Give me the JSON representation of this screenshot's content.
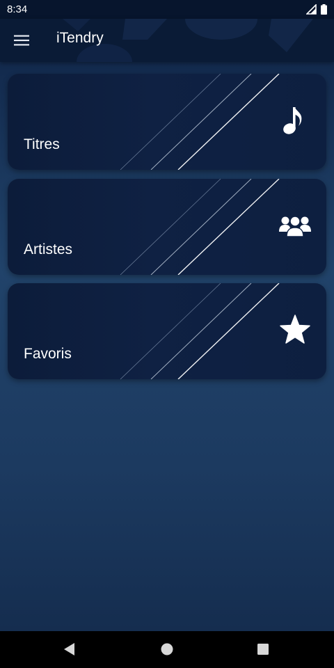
{
  "status_bar": {
    "time": "8:34",
    "icons": [
      "signal-icon",
      "battery-icon"
    ]
  },
  "app_bar": {
    "menu_icon": "hamburger-menu-icon",
    "title": "iTendry"
  },
  "cards": [
    {
      "label": "Titres",
      "icon": "music-note-icon"
    },
    {
      "label": "Artistes",
      "icon": "group-icon"
    },
    {
      "label": "Favoris",
      "icon": "star-icon"
    }
  ],
  "nav_bar": {
    "buttons": [
      "back-icon",
      "home-icon",
      "recents-icon"
    ]
  },
  "colors": {
    "background_top": "#0e2244",
    "background_mid": "#21436a",
    "card_background": "#0f2143",
    "app_bar": "#0a1b36",
    "text": "#ffffff"
  }
}
